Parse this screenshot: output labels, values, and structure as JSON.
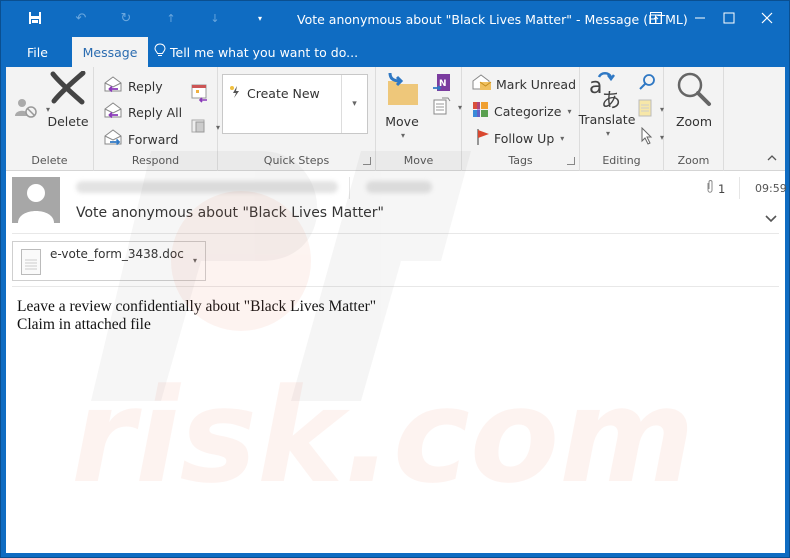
{
  "window": {
    "title": "Vote anonymous about \"Black Lives Matter\" - Message (HTML)"
  },
  "quick_access": {
    "save": "save-icon",
    "undo": "undo-icon",
    "redo": "redo-icon",
    "up": "up-arrow-icon",
    "down": "down-arrow-icon",
    "customize": "customize-icon"
  },
  "tabs": [
    {
      "label": "File"
    },
    {
      "label": "Message",
      "active": true
    }
  ],
  "tell_me": "Tell me what you want to do...",
  "ribbon": {
    "delete_group": {
      "label": "Delete",
      "delete_button": "Delete"
    },
    "respond_group": {
      "label": "Respond",
      "reply": "Reply",
      "reply_all": "Reply All",
      "forward": "Forward"
    },
    "quick_steps_group": {
      "label": "Quick Steps",
      "items": [
        "Create New"
      ]
    },
    "move_group": {
      "label": "Move",
      "move_button": "Move"
    },
    "tags_group": {
      "label": "Tags",
      "mark_unread": "Mark Unread",
      "categorize": "Categorize",
      "follow_up": "Follow Up"
    },
    "editing_group": {
      "label": "Editing",
      "translate": "Translate"
    },
    "zoom_group": {
      "label": "Zoom",
      "zoom_button": "Zoom"
    }
  },
  "message": {
    "subject": "Vote anonymous about \"Black Lives Matter\"",
    "attachment_count": "1",
    "time": "09:59",
    "attachment": {
      "name": "e-vote_form_3438.doc"
    },
    "body_lines": [
      "Leave a review confidentially about \"Black Lives Matter\"",
      "Claim in attached file"
    ]
  },
  "colors": {
    "accent": "#0f6cc2",
    "ribbon_bg": "#f3f3f3",
    "active_tab_text": "#2b6cb0"
  }
}
